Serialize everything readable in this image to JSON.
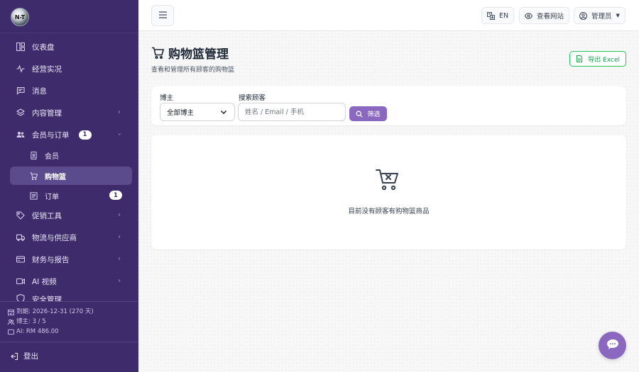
{
  "sidebar": {
    "logo_text": "N-T",
    "items": [
      {
        "label": "仪表盘",
        "icon": "dashboard-icon"
      },
      {
        "label": "经营实况",
        "icon": "activity-icon"
      },
      {
        "label": "消息",
        "icon": "message-icon"
      },
      {
        "label": "内容管理",
        "icon": "layers-icon"
      },
      {
        "label": "会员与订单",
        "icon": "users-icon",
        "badge": "1"
      },
      {
        "label": "会员",
        "icon": "member-card-icon"
      },
      {
        "label": "购物篮",
        "icon": "cart-icon"
      },
      {
        "label": "订单",
        "icon": "order-icon",
        "badge": "1"
      },
      {
        "label": "促销工具",
        "icon": "tag-icon"
      },
      {
        "label": "物流与供应商",
        "icon": "truck-icon"
      },
      {
        "label": "财务与报告",
        "icon": "finance-icon"
      },
      {
        "label": "AI 视频",
        "icon": "video-icon"
      },
      {
        "label": "安全管理",
        "icon": "shield-icon"
      }
    ],
    "info": {
      "expiry": "到期: 2026-12-31 (270 天)",
      "bloggers": "博主: 3 / 5",
      "ai": "AI: RM 486.00"
    },
    "logout": "登出"
  },
  "topbar": {
    "lang": "EN",
    "view_site": "查看网站",
    "user": "管理员"
  },
  "page": {
    "title": "购物篮管理",
    "subtitle": "查看和管理所有顾客的购物篮",
    "export": "导出 Excel"
  },
  "filter": {
    "blogger_label": "博主",
    "blogger_value": "全部博主",
    "search_label": "搜索顾客",
    "search_placeholder": "姓名 / Email / 手机",
    "button": "筛选"
  },
  "empty": {
    "message": "目前没有顾客有购物篮商品"
  },
  "colors": {
    "sidebar": "#3d2b6b",
    "accent": "#8b68c0",
    "export": "#16a34a"
  }
}
